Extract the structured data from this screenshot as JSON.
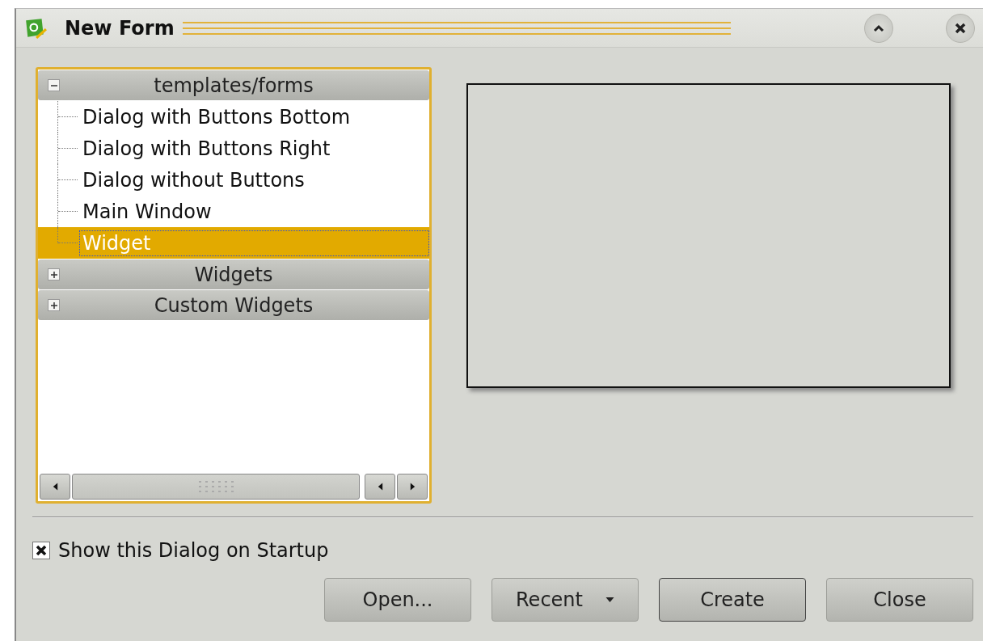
{
  "window": {
    "title": "New Form"
  },
  "tree": [
    {
      "label": "templates/forms",
      "expanded": true,
      "children": [
        {
          "label": "Dialog with Buttons Bottom",
          "selected": false
        },
        {
          "label": "Dialog with Buttons Right",
          "selected": false
        },
        {
          "label": "Dialog without Buttons",
          "selected": false
        },
        {
          "label": "Main Window",
          "selected": false
        },
        {
          "label": "Widget",
          "selected": true
        }
      ]
    },
    {
      "label": "Widgets",
      "expanded": false
    },
    {
      "label": "Custom Widgets",
      "expanded": false
    }
  ],
  "show_on_startup": {
    "label": "Show this Dialog on Startup",
    "checked": true
  },
  "buttons": [
    {
      "label": "Open...",
      "kind": "push",
      "default": false
    },
    {
      "label": "Recent",
      "kind": "menu",
      "default": false
    },
    {
      "label": "Create",
      "kind": "push",
      "default": true
    },
    {
      "label": "Close",
      "kind": "push",
      "default": false
    }
  ]
}
